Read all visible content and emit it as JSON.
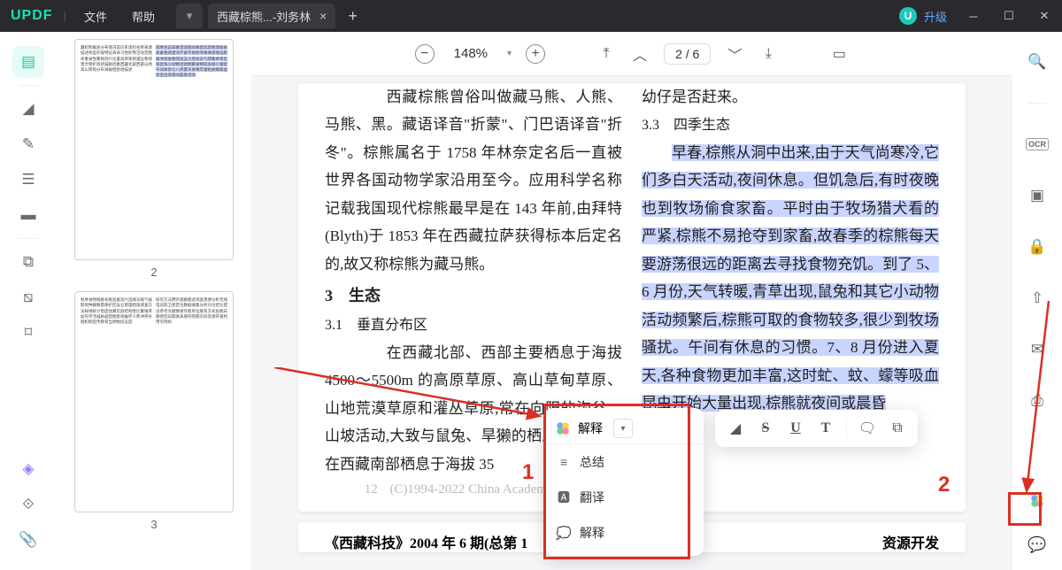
{
  "app": {
    "logo": "UPDF"
  },
  "menu": {
    "file": "文件",
    "help": "帮助"
  },
  "tab": {
    "title": "西藏棕熊...-刘务林"
  },
  "upgrade": {
    "avatar": "U",
    "label": "升级"
  },
  "toolbar": {
    "zoom": "148%",
    "page_current": "2",
    "page_total": "6"
  },
  "thumbs": {
    "p2": "2",
    "p3": "3"
  },
  "doc": {
    "col1": {
      "p1": "　　西藏棕熊曾俗叫做藏马熊、人熊、马熊、黑。藏语译音\"折蒙\"、门巴语译音\"折冬\"。棕熊属名于 1758 年林奈定名后一直被世界各国动物学家沿用至今。应用科学名称记载我国现代棕熊最早是在 143 年前,由拜特(Blyth)于 1853 年在西藏拉萨获得标本后定名的,故又称棕熊为藏马熊。",
      "h_eco": "3　生态",
      "h_sub": "3.1　垂直分布区",
      "p2": "　　在西藏北部、西部主要栖息于海拔 4500～5500m 的高原草原、高山草甸草原、山地荒漠草原和灌丛草原,常在向阳的沟谷、山坡活动,大致与鼠兔、旱獭的栖息地相吻合; 在西藏南部栖息于海拔 35",
      "pagenum": "12",
      "copyright": "(C)1994-2022 China Academic Jour"
    },
    "col2": {
      "p1": "幼仔是否赶来。",
      "h_sub": "3.3　四季生态",
      "p2_hi": "早春,棕熊从洞中出来,由于天气尚寒冷,它们多白天活动,夜间休息。但饥急后,有时夜晚也到牧场偷食家畜。平时由于牧场猎犬看的严紧,棕熊不易抢夺到家畜,故春季的棕熊每天要游荡很远的距离去寻找食物充饥。到了 5、6 月份,天气转暖,青草出现,鼠兔和其它小动物活动频繁后,棕熊可取的食物较多,很少到牧场骚扰。午间有休息的习惯。7、8 月份进入夏天,各种食物更加丰富,这时虻、蚊、蠓等吸血昆虫开始大量出现,棕熊就夜间或晨昏"
    },
    "issue_left": "《西藏科技》2004 年 6 期(总第 1",
    "issue_right": "资源开发"
  },
  "ctx": {
    "head": "解释",
    "summary": "总结",
    "translate": "翻译",
    "explain": "解释"
  },
  "annot": {
    "n1": "1",
    "n2": "2"
  },
  "right": {
    "ocr": "OCR"
  }
}
